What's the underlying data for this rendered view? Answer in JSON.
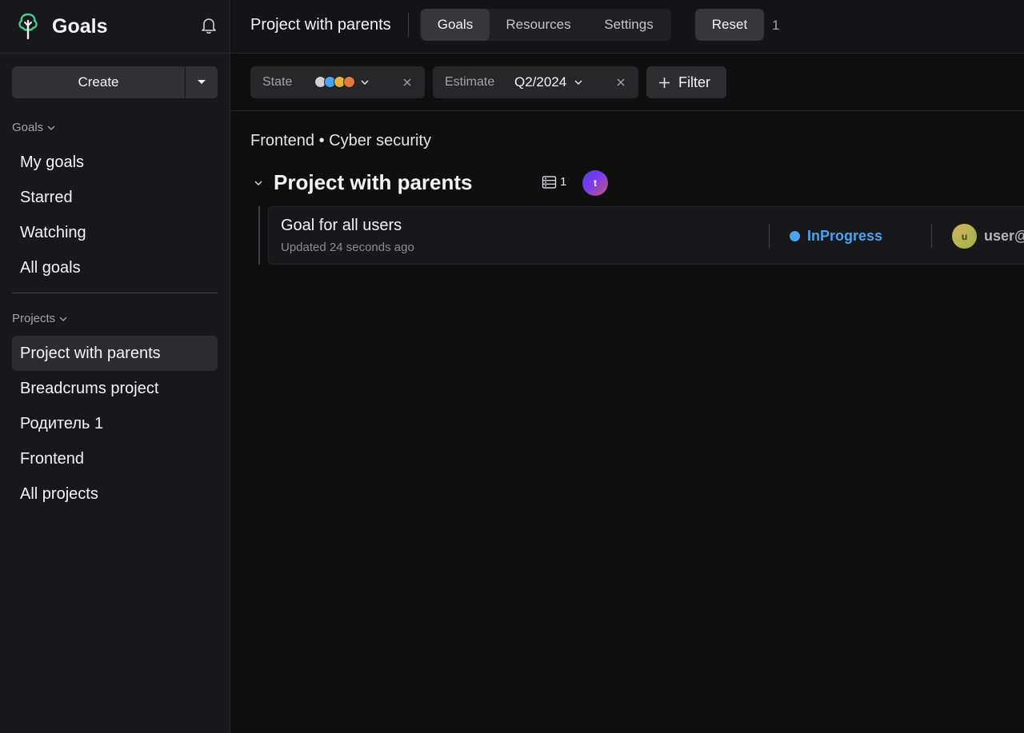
{
  "app": {
    "title": "Goals"
  },
  "sidebar": {
    "create_label": "Create",
    "goals_section_label": "Goals",
    "goals_items": [
      {
        "label": "My goals"
      },
      {
        "label": "Starred"
      },
      {
        "label": "Watching"
      },
      {
        "label": "All goals"
      }
    ],
    "projects_section_label": "Projects",
    "project_items": [
      {
        "label": "Project with parents",
        "active": true
      },
      {
        "label": "Breadcrums project"
      },
      {
        "label": "Родитель 1"
      },
      {
        "label": "Frontend"
      },
      {
        "label": "All projects"
      }
    ]
  },
  "header": {
    "project_title": "Project with parents",
    "tabs": [
      {
        "label": "Goals",
        "active": true
      },
      {
        "label": "Resources"
      },
      {
        "label": "Settings"
      }
    ],
    "reset_label": "Reset",
    "reset_count": "1"
  },
  "filters": {
    "state": {
      "label": "State",
      "dot_colors": [
        "#cfcfd6",
        "#4aa3f0",
        "#e3b341",
        "#e07a3c"
      ]
    },
    "estimate": {
      "label": "Estimate",
      "value": "Q2/2024"
    },
    "add_filter_label": "Filter"
  },
  "main": {
    "breadcrumb": "Frontend • Cyber security",
    "group": {
      "title": "Project with parents",
      "goals_count": "1",
      "owner_initial": "t",
      "goals": [
        {
          "title": "Goal for all users",
          "updated": "Updated 24 seconds ago",
          "state": "InProgress",
          "state_color": "#4aa3f0",
          "assignee_initial": "u",
          "assignee_name": "user@"
        }
      ]
    }
  }
}
